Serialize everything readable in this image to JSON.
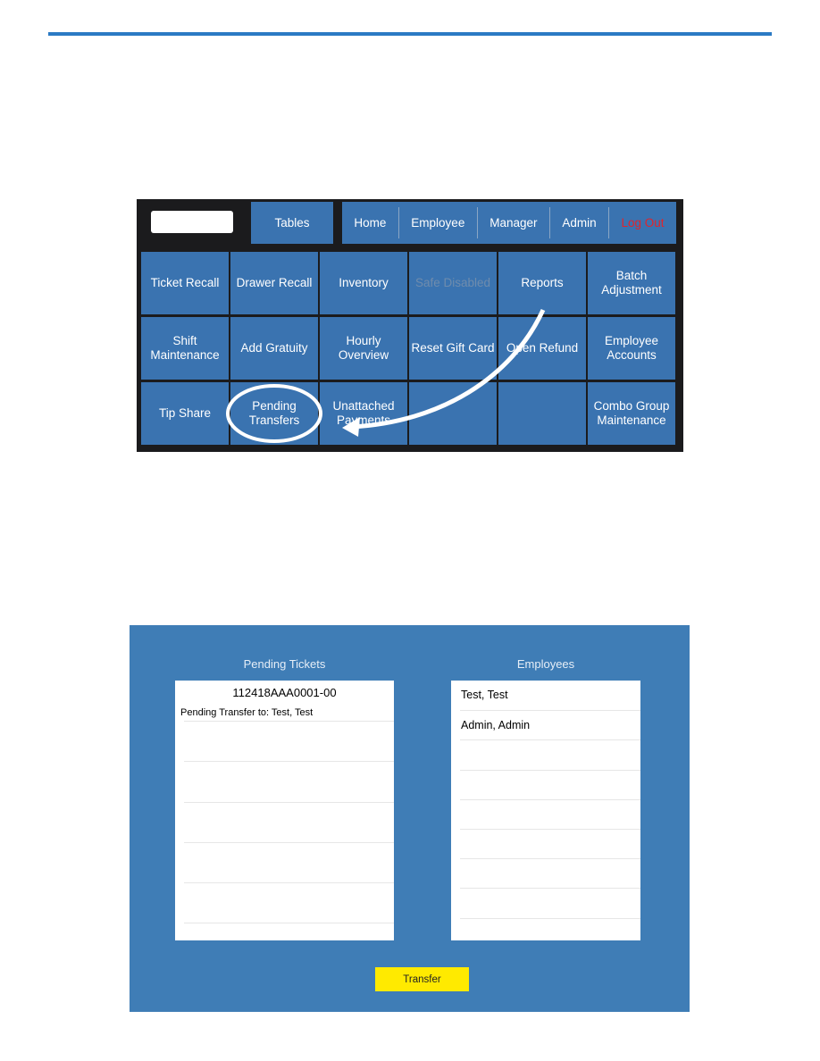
{
  "accent_color": "#2b7ac4",
  "pos_screen": {
    "top": {
      "tables": "Tables",
      "nav": [
        "Home",
        "Employee",
        "Manager",
        "Admin",
        "Log Out"
      ]
    },
    "grid": [
      [
        "Ticket Recall",
        "Drawer Recall",
        "Inventory",
        "Safe Disabled",
        "Reports",
        "Batch Adjustment"
      ],
      [
        "Shift Maintenance",
        "Add Gratuity",
        "Hourly Overview",
        "Reset Gift Card",
        "Open Refund",
        "Employee Accounts"
      ],
      [
        "Tip Share",
        "Pending Transfers",
        "Unattached Payments",
        "",
        "",
        "Combo Group Maintenance"
      ]
    ]
  },
  "transfer_screen": {
    "pending_title": "Pending Tickets",
    "employees_title": "Employees",
    "ticket_id": "112418AAA0001-00",
    "ticket_status": "Pending Transfer to: Test, Test",
    "employees": [
      "Test, Test",
      "Admin, Admin"
    ],
    "transfer_label": "Transfer"
  }
}
